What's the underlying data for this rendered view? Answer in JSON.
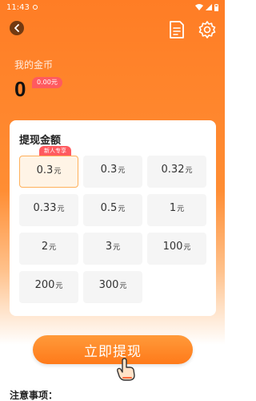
{
  "status_bar": {
    "time": "11:43"
  },
  "header": {
    "back_icon": "back-chevron-icon",
    "doc_icon": "document-icon",
    "settings_icon": "gear-icon"
  },
  "balance": {
    "label": "我的金币",
    "value": "0",
    "badge": "0.00元"
  },
  "withdraw": {
    "title": "提现金额",
    "new_user_tag": "新人专享",
    "options": [
      {
        "amount": "0.3",
        "unit": "元",
        "selected": true
      },
      {
        "amount": "0.3",
        "unit": "元"
      },
      {
        "amount": "0.32",
        "unit": "元"
      },
      {
        "amount": "0.33",
        "unit": "元"
      },
      {
        "amount": "0.5",
        "unit": "元"
      },
      {
        "amount": "1",
        "unit": "元"
      },
      {
        "amount": "2",
        "unit": "元"
      },
      {
        "amount": "3",
        "unit": "元"
      },
      {
        "amount": "100",
        "unit": "元"
      },
      {
        "amount": "200",
        "unit": "元"
      },
      {
        "amount": "300",
        "unit": "元"
      }
    ]
  },
  "cta": {
    "label": "立即提现"
  },
  "notes": {
    "title": "注意事项："
  },
  "colors": {
    "accent": "#ff7d25",
    "badge": "#ff5a5f",
    "tile_bg": "#f5f5f5",
    "tile_selected_border": "#ffb05a"
  }
}
